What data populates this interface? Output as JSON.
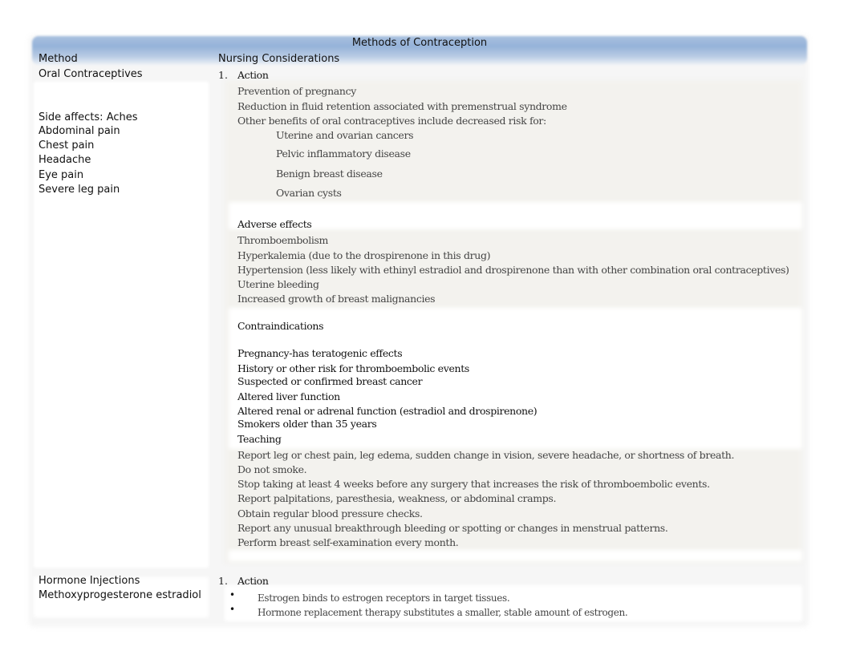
{
  "document": {
    "title": "Methods of Contraception",
    "columns": {
      "method": "Method",
      "nursing": "Nursing Considerations"
    },
    "rows": [
      {
        "method": "Oral Contraceptives",
        "side_effects": [
          "Side affects: Aches",
          "Abdominal pain",
          "Chest pain",
          "Headache",
          "Eye pain",
          "Severe leg pain"
        ],
        "list_number": "1.",
        "action_heading": "Action",
        "action_items": [
          "Prevention of pregnancy",
          "Reduction in fluid retention associated with premenstrual syndrome",
          "Other benefits of oral contraceptives include decreased risk for:"
        ],
        "benefits": [
          "Uterine and ovarian cancers",
          "Pelvic inflammatory disease",
          "Benign breast disease",
          "Ovarian cysts"
        ],
        "adverse_heading": "Adverse effects",
        "adverse_items": [
          "Thromboembolism",
          "Hyperkalemia (due to the drospirenone in this drug)",
          "Hypertension (less likely with ethinyl estradiol and drospirenone than with other combination oral contraceptives)",
          "Uterine bleeding",
          "Increased growth of breast malignancies"
        ],
        "contra_heading": "Contraindications",
        "contra_items": [
          "Pregnancy-has teratogenic effects",
          "History or other risk for thromboembolic events",
          "Suspected or confirmed breast cancer",
          "Altered liver function",
          "Altered renal or adrenal function (estradiol and drospirenone)",
          "Smokers older than 35 years"
        ],
        "teaching_heading": "Teaching",
        "teaching_items": [
          "Report leg or chest pain, leg edema, sudden change in vision, severe headache, or shortness of breath.",
          "Do not smoke.",
          "Stop taking at least 4 weeks before any surgery that increases the risk of thromboembolic events.",
          "Report palpitations, paresthesia, weakness, or abdominal cramps.",
          "Obtain regular blood pressure checks.",
          "Report any unusual breakthrough bleeding or spotting or changes in menstrual patterns.",
          "Perform breast self-examination every month."
        ]
      },
      {
        "method": "Hormone Injections",
        "method_sub": "Methoxyprogesterone estradiol",
        "list_number": "1.",
        "action_heading": "Action",
        "bullet_glyph": "•",
        "action_items": [
          "Estrogen binds to estrogen receptors in target tissues.",
          "Hormone replacement therapy substitutes a smaller, stable amount of estrogen."
        ]
      }
    ]
  }
}
